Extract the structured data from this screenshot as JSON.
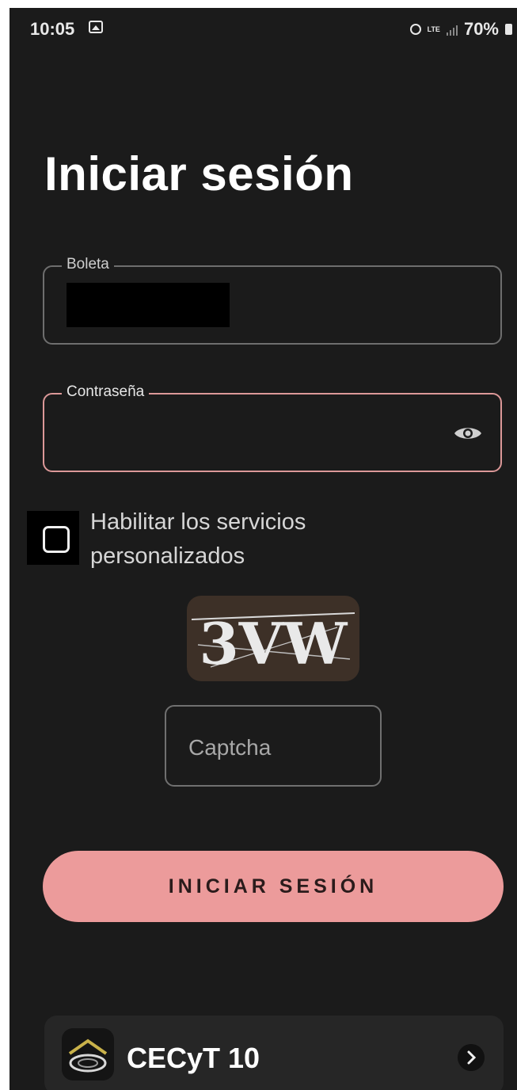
{
  "status_bar": {
    "time": "10:05",
    "network": "LTE",
    "battery": "70%"
  },
  "page": {
    "title": "Iniciar sesión"
  },
  "form": {
    "boleta_label": "Boleta",
    "password_label": "Contraseña",
    "checkbox_label": "Habilitar los servicios personalizados",
    "checkbox_checked": false,
    "captcha_image_text": "3VW",
    "captcha_placeholder": "Captcha",
    "submit_label": "INICIAR SESIÓN"
  },
  "school": {
    "name": "CECyT 10"
  },
  "colors": {
    "background": "#1b1b1b",
    "accent": "#ec9b9b",
    "focused_border": "#dc9898"
  },
  "icons": [
    "image-icon",
    "alarm-icon",
    "signal-icon",
    "battery-icon",
    "eye-icon",
    "checkbox",
    "school-logo",
    "chevron-right-icon"
  ]
}
